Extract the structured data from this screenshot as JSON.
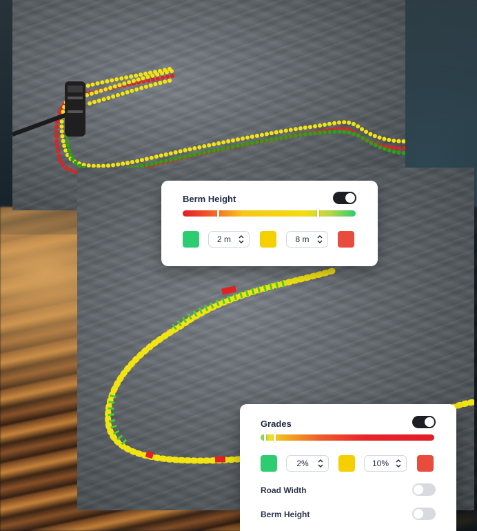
{
  "berm_card": {
    "title": "Berm Height",
    "toggle_on": true,
    "low_color": "#2ecc71",
    "mid_color": "#f5d000",
    "high_color": "#e74c3c",
    "threshold_low": "2 m",
    "threshold_high": "8 m",
    "gradient_markers": [
      0.2,
      0.8
    ]
  },
  "grades_card": {
    "title": "Grades",
    "toggle_on": true,
    "low_color": "#2ecc71",
    "mid_color": "#f5d000",
    "high_color": "#e74c3c",
    "threshold_low": "2%",
    "threshold_high": "10%",
    "gradient_markers": [
      0.02,
      0.08
    ],
    "layers": [
      {
        "label": "Road Width",
        "enabled": false
      },
      {
        "label": "Berm Height",
        "enabled": false
      }
    ]
  },
  "icons": [
    "chevron-up-down-icon",
    "lidar-sensor-icon"
  ]
}
